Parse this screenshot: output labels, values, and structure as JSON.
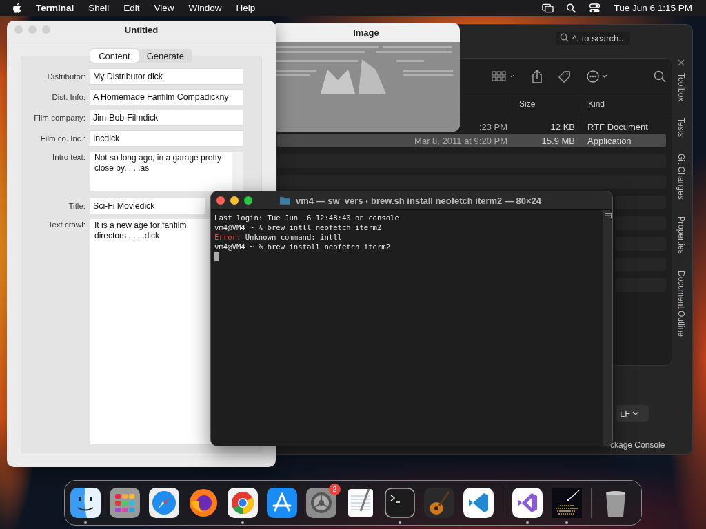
{
  "menu_bar": {
    "app": "Terminal",
    "menus": [
      "Shell",
      "Edit",
      "View",
      "Window",
      "Help"
    ],
    "clock": "Tue Jun 6  1:15 PM"
  },
  "ide_window": {
    "search_placeholder": "^, to search...",
    "columns": [
      "Size",
      "Kind"
    ],
    "rows": [
      {
        "date": ":23 PM",
        "size": "12 KB",
        "file_kind": "RTF Document",
        "selected": false
      },
      {
        "date": "Mar 8, 2011 at 9:20 PM",
        "size": "15.9 MB",
        "file_kind": "Application",
        "selected": true
      }
    ],
    "side_tabs": [
      "Toolbox",
      "Tests",
      "Git Changes",
      "Properties",
      "Document Outline"
    ],
    "line_ending": "LF",
    "bottom_tab": "ckage Console"
  },
  "form_window": {
    "title": "Untitled",
    "tabs": [
      {
        "label": "Content",
        "selected": true
      },
      {
        "label": "Generate",
        "selected": false
      }
    ],
    "fields": [
      {
        "label": "Distributor:",
        "value": "My Distributor dick",
        "kind": "line"
      },
      {
        "label": "Dist. Info:",
        "value": "A Homemade Fanfilm Compadickny",
        "kind": "line"
      },
      {
        "label": "Film company:",
        "value": "Jim-Bob-Filmdick",
        "kind": "line"
      },
      {
        "label": "Film co. Inc.:",
        "value": "Incdick",
        "kind": "line"
      },
      {
        "label": "Intro text:",
        "value": "Not so long ago, in a garage pretty close by. . . .as",
        "kind": "area"
      },
      {
        "label": "Title:",
        "value": "Sci-Fi Moviedick",
        "kind": "line"
      },
      {
        "label": "Text crawl:",
        "value": "It is a new age for fanfilm directors . . . .dick",
        "kind": "tall_area"
      }
    ]
  },
  "image_window": {
    "title": "Image",
    "kind": "picture"
  },
  "terminal": {
    "title": "vm4 — sw_vers ‹ brew.sh install neofetch iterm2 — 80×24",
    "lines": [
      {
        "kind": "plain",
        "text": "Last login: Tue Jun  6 12:48:40 on console"
      },
      {
        "kind": "prompt",
        "text": "vm4@VM4 ~ % brew intll neofetch iterm2"
      },
      {
        "kind": "error",
        "label": "Error:",
        "text": "Unknown command: intll"
      },
      {
        "kind": "prompt",
        "text": "vm4@VM4 ~ % brew install neofetch iterm2"
      }
    ]
  },
  "dock": {
    "apps": [
      {
        "kind": "finder",
        "running": true
      },
      {
        "kind": "launchpad",
        "running": false
      },
      {
        "kind": "safari",
        "running": false
      },
      {
        "kind": "firefox",
        "running": false
      },
      {
        "kind": "chrome",
        "running": true
      },
      {
        "kind": "appstore",
        "running": false
      },
      {
        "kind": "settings",
        "running": false,
        "badge": "2"
      },
      {
        "kind": "textedit",
        "running": false
      },
      {
        "kind": "terminal",
        "running": true
      },
      {
        "kind": "guitar",
        "running": false
      },
      {
        "kind": "vscode",
        "running": false
      },
      {
        "kind": "separator"
      },
      {
        "kind": "vstudio",
        "running": true
      },
      {
        "kind": "starfield",
        "running": true
      },
      {
        "kind": "separator"
      },
      {
        "kind": "trash",
        "running": false
      }
    ]
  }
}
